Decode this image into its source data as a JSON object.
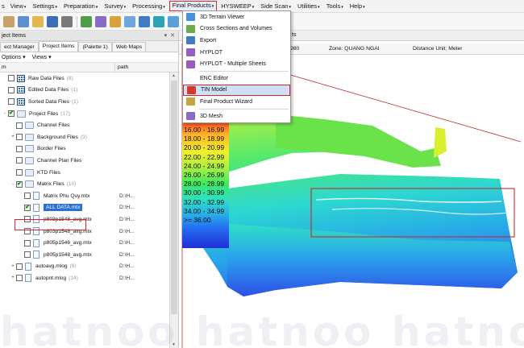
{
  "menubar": {
    "items": [
      "View",
      "Settings",
      "Preparation",
      "Survey",
      "Processing",
      "Final Products",
      "HYSWEEP",
      "Side Scan",
      "Utilities",
      "Tools",
      "Help"
    ],
    "active_index": 5,
    "partial_left": "s"
  },
  "left_panel": {
    "title": "ject Items",
    "title_buttons": [
      "▾",
      "✕"
    ],
    "tabs": [
      "ect Manager",
      "Project Items",
      "(Palette 1)",
      "Web Maps"
    ],
    "selected_tab": 1,
    "options_label": "Options",
    "views_label": "Views",
    "col_name": "m",
    "col_path": "path",
    "rows": [
      {
        "label": "Raw Data Files",
        "count": "(8)",
        "path": "",
        "icon": "grid",
        "expand": "",
        "checked": false,
        "indent": 0
      },
      {
        "label": "Edited Data Files",
        "count": "(1)",
        "path": "",
        "icon": "grid",
        "expand": "",
        "checked": false,
        "indent": 0
      },
      {
        "label": "Sorted Data Files",
        "count": "(1)",
        "path": "",
        "icon": "grid",
        "expand": "",
        "checked": false,
        "indent": 0
      },
      {
        "label": "Project Files",
        "count": "(17)",
        "path": "",
        "icon": "folder",
        "expand": "-",
        "checked": true,
        "indent": 0
      },
      {
        "label": "Channel Files",
        "count": "",
        "path": "",
        "icon": "folder",
        "expand": "",
        "checked": false,
        "indent": 1
      },
      {
        "label": "Background Files",
        "count": "(3)",
        "path": "",
        "icon": "folder",
        "expand": "+",
        "checked": false,
        "indent": 1
      },
      {
        "label": "Border Files",
        "count": "",
        "path": "",
        "icon": "folder",
        "expand": "",
        "checked": false,
        "indent": 1
      },
      {
        "label": "Channel Plan Files",
        "count": "",
        "path": "",
        "icon": "folder",
        "expand": "",
        "checked": false,
        "indent": 1
      },
      {
        "label": "KTD Files",
        "count": "",
        "path": "",
        "icon": "folder",
        "expand": "",
        "checked": false,
        "indent": 1
      },
      {
        "label": "Matrix Files",
        "count": "(10)",
        "path": "",
        "icon": "folder",
        "expand": "-",
        "checked": true,
        "indent": 1
      },
      {
        "label": "Matrix Phu Quy.mtx",
        "count": "",
        "path": "D:\\H...",
        "icon": "file",
        "expand": "",
        "checked": false,
        "indent": 2
      },
      {
        "label": "ALL DATA.mtx",
        "count": "",
        "path": "D:\\H...",
        "icon": "file",
        "expand": "",
        "checked": true,
        "indent": 2
      },
      {
        "label": "p803p1548_avg.mtx",
        "count": "",
        "path": "D:\\H...",
        "icon": "file",
        "expand": "",
        "checked": false,
        "indent": 2
      },
      {
        "label": "p803p1548_avg.mtx",
        "count": "",
        "path": "D:\\H...",
        "icon": "file",
        "expand": "",
        "checked": false,
        "indent": 2
      },
      {
        "label": "p805p1546_avg.mtx",
        "count": "",
        "path": "D:\\H...",
        "icon": "file",
        "expand": "",
        "checked": false,
        "indent": 2
      },
      {
        "label": "p805p1548_avg.mtx",
        "count": "",
        "path": "D:\\H...",
        "icon": "file",
        "expand": "",
        "checked": false,
        "indent": 2
      },
      {
        "label": "autoavg.mlog",
        "count": "(6)",
        "path": "D:\\H...",
        "icon": "file",
        "expand": "+",
        "checked": false,
        "indent": 1
      },
      {
        "label": "autopnt.mlog",
        "count": "(14)",
        "path": "D:\\H...",
        "icon": "file",
        "expand": "+",
        "checked": false,
        "indent": 1
      }
    ]
  },
  "viewer": {
    "tab_partial": "ts",
    "status_coord": "980",
    "status_zone": "Zone: QUANG NGAI",
    "status_units": "Distance Unit: Meter",
    "legend": [
      "16.00 - 16.99",
      "18.00 - 18.99",
      "20.00 - 20.99",
      "22.00 - 22.99",
      "24.00 - 24.99",
      "26.00 - 26.99",
      "28.00 - 28.99",
      "30.00 - 30.99",
      "32.00 - 32.99",
      "34.00 - 34.99",
      ">= 36.00"
    ]
  },
  "dropdown": {
    "items": [
      {
        "label": "3D Terrain Viewer",
        "icon_color": "#4a8fd9"
      },
      {
        "label": "Cross Sections and Volumes",
        "icon_color": "#6cab4b"
      },
      {
        "label": "Export",
        "icon_color": "#3f7cc4"
      },
      {
        "label": "HYPLOT",
        "icon_color": "#9b5cc0"
      },
      {
        "label": "HYPLOT - Multiple Sheets",
        "icon_color": "#9b5cc0"
      },
      {
        "label": "ENC Editor",
        "icon_color": ""
      },
      {
        "label": "TIN Model",
        "icon_color": "#d9362b"
      },
      {
        "label": "Final Product Wizard",
        "icon_color": "#c8a43c"
      },
      {
        "label": "3D Mesh",
        "icon_color": "#8a6bc8"
      }
    ],
    "highlighted_index": 6
  },
  "watermark": {
    "text": "hatnoo hatnoo hatnoo hatnoo"
  }
}
